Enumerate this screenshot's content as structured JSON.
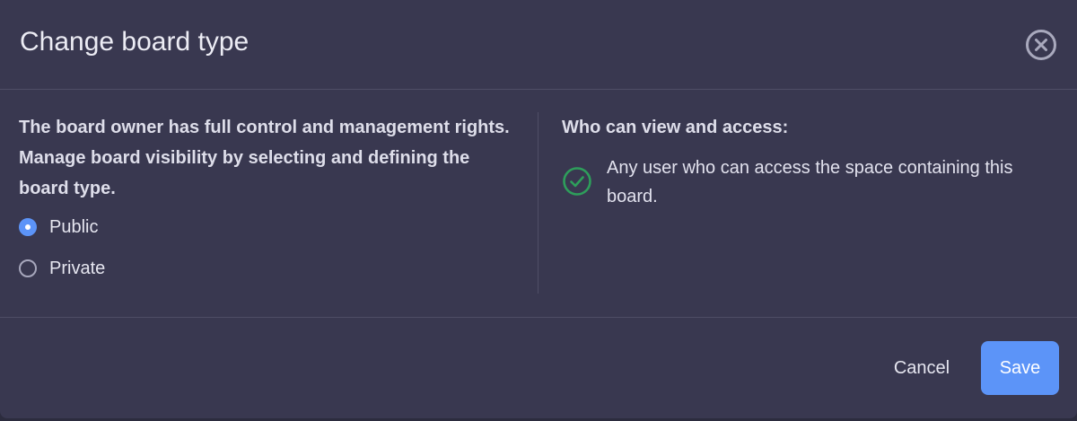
{
  "dialog": {
    "title": "Change board type",
    "close_icon": "close-circle-icon",
    "description": "The board owner has full control and management rights. Manage board visibility by selecting and defining the board type.",
    "board_type_options": [
      {
        "label": "Public",
        "selected": true
      },
      {
        "label": "Private",
        "selected": false
      }
    ],
    "access": {
      "heading": "Who can view and access:",
      "icon": "check-circle-icon",
      "items": [
        "Any user who can access the space containing this board."
      ]
    },
    "footer": {
      "cancel_label": "Cancel",
      "save_label": "Save"
    }
  },
  "colors": {
    "dialog_background": "#393850",
    "accent": "#5c94f8",
    "success": "#2e9e5b",
    "divider": "#4f4e66"
  }
}
